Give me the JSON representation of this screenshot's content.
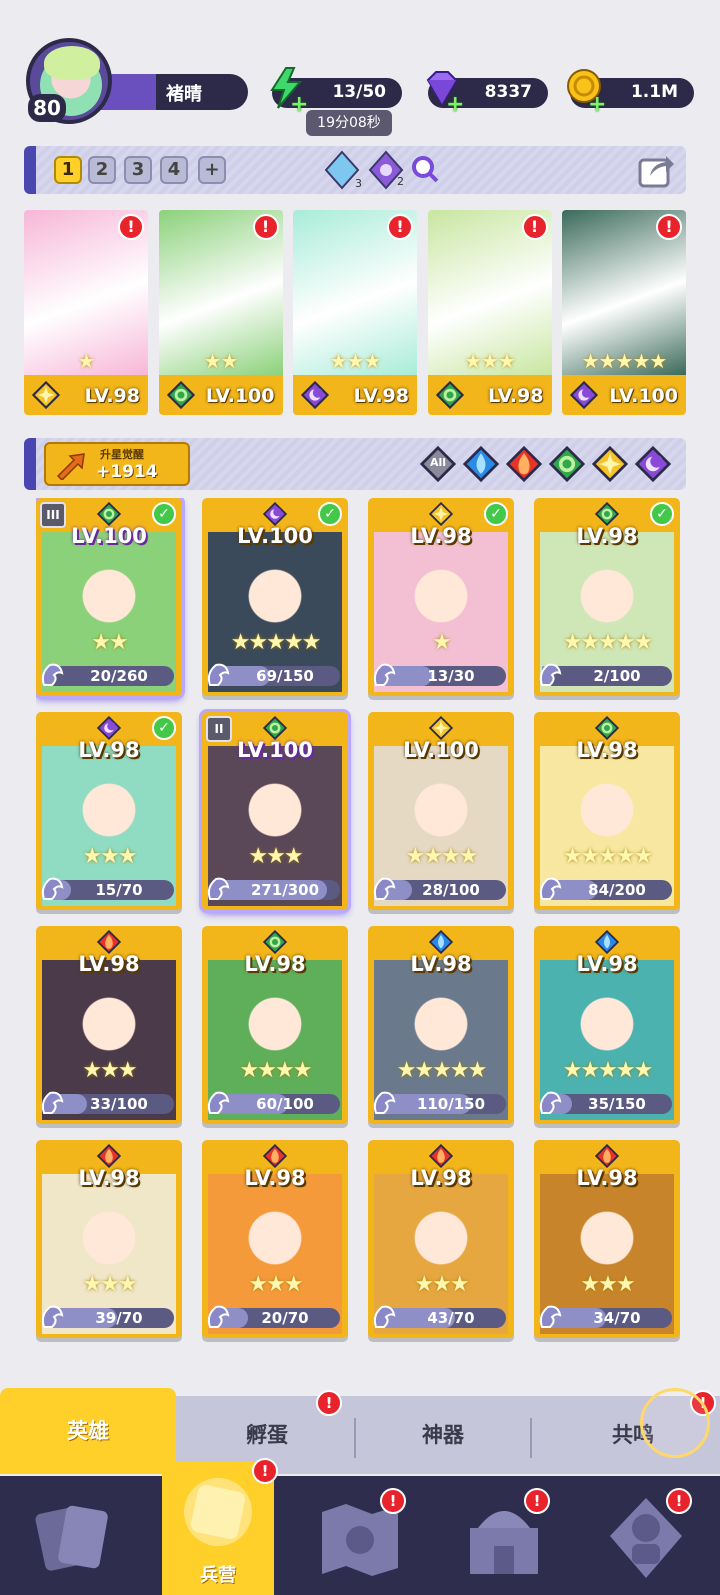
{
  "player": {
    "level": "80",
    "name": "褚晴"
  },
  "resources": {
    "energy": "13/50",
    "energy_timer": "19分08秒",
    "gems": "8337",
    "coins": "1.1M"
  },
  "team": {
    "slots": [
      "1",
      "2",
      "3",
      "4",
      "+"
    ],
    "slot_active": 0,
    "counter_a": "3",
    "counter_b": "2",
    "cards": [
      {
        "level": "LV.98",
        "element": "light",
        "stars": "★",
        "alert": "!"
      },
      {
        "level": "LV.100",
        "element": "nature",
        "stars": "★★",
        "alert": "!"
      },
      {
        "level": "LV.98",
        "element": "dark",
        "stars": "★★★",
        "alert": "!"
      },
      {
        "level": "LV.98",
        "element": "nature",
        "stars": "★★★",
        "alert": "!"
      },
      {
        "level": "LV.100",
        "element": "dark",
        "stars": "★★★★★",
        "alert": "!"
      }
    ]
  },
  "awaken": {
    "title": "升星觉醒",
    "value": "+1914"
  },
  "filters": [
    "All",
    "water",
    "fire",
    "nature",
    "light",
    "dark"
  ],
  "filter_all_label": "All",
  "heroes": [
    {
      "level": "LV.100",
      "element": "nature",
      "stars": "★★",
      "progress": "20/260",
      "fill": 0.08,
      "check": true,
      "tier": "III",
      "highlight": true,
      "purple": true,
      "art": "#8bd17a"
    },
    {
      "level": "LV.100",
      "element": "dark",
      "stars": "★★★★★",
      "progress": "69/150",
      "fill": 0.46,
      "check": true,
      "tier": "",
      "highlight": false,
      "purple": false,
      "art": "#3b4a5a"
    },
    {
      "level": "LV.98",
      "element": "light",
      "stars": "★",
      "progress": "13/30",
      "fill": 0.43,
      "check": true,
      "tier": "",
      "highlight": false,
      "purple": false,
      "art": "#f2c0d2"
    },
    {
      "level": "LV.98",
      "element": "nature",
      "stars": "★★★★★",
      "progress": "2/100",
      "fill": 0.02,
      "check": true,
      "tier": "",
      "highlight": false,
      "purple": false,
      "art": "#cfe7b6"
    },
    {
      "level": "LV.98",
      "element": "dark",
      "stars": "★★★",
      "progress": "15/70",
      "fill": 0.21,
      "check": true,
      "tier": "",
      "highlight": false,
      "purple": false,
      "art": "#8fdcc2"
    },
    {
      "level": "LV.100",
      "element": "nature",
      "stars": "★★★",
      "progress": "271/300",
      "fill": 0.9,
      "check": false,
      "tier": "II",
      "highlight": true,
      "purple": true,
      "art": "#5a4858"
    },
    {
      "level": "LV.100",
      "element": "light",
      "stars": "★★★★",
      "progress": "28/100",
      "fill": 0.28,
      "check": false,
      "tier": "",
      "highlight": false,
      "purple": false,
      "art": "#e6d9c4"
    },
    {
      "level": "LV.98",
      "element": "nature",
      "stars": "★★★★★",
      "progress": "84/200",
      "fill": 0.42,
      "check": false,
      "tier": "",
      "highlight": false,
      "purple": false,
      "art": "#f7e7a0"
    },
    {
      "level": "LV.98",
      "element": "fire",
      "stars": "★★★",
      "progress": "33/100",
      "fill": 0.33,
      "check": false,
      "tier": "",
      "highlight": false,
      "purple": false,
      "art": "#4a3a4a"
    },
    {
      "level": "LV.98",
      "element": "nature",
      "stars": "★★★★",
      "progress": "60/100",
      "fill": 0.6,
      "check": false,
      "tier": "",
      "highlight": false,
      "purple": false,
      "art": "#5fae5a"
    },
    {
      "level": "LV.98",
      "element": "water",
      "stars": "★★★★★",
      "progress": "110/150",
      "fill": 0.73,
      "check": false,
      "tier": "",
      "highlight": false,
      "purple": false,
      "art": "#6a7a8c"
    },
    {
      "level": "LV.98",
      "element": "water",
      "stars": "★★★★★",
      "progress": "35/150",
      "fill": 0.23,
      "check": false,
      "tier": "",
      "highlight": false,
      "purple": false,
      "art": "#4bb2b0"
    },
    {
      "level": "LV.98",
      "element": "fire",
      "stars": "★★★",
      "progress": "39/70",
      "fill": 0.56,
      "check": false,
      "tier": "",
      "highlight": false,
      "purple": false,
      "art": "#f0e6c8"
    },
    {
      "level": "LV.98",
      "element": "fire",
      "stars": "★★★",
      "progress": "20/70",
      "fill": 0.29,
      "check": false,
      "tier": "",
      "highlight": false,
      "purple": false,
      "art": "#f59a3a"
    },
    {
      "level": "LV.98",
      "element": "fire",
      "stars": "★★★",
      "progress": "43/70",
      "fill": 0.61,
      "check": false,
      "tier": "",
      "highlight": false,
      "purple": false,
      "art": "#e6a640"
    },
    {
      "level": "LV.98",
      "element": "fire",
      "stars": "★★★",
      "progress": "34/70",
      "fill": 0.49,
      "check": false,
      "tier": "",
      "highlight": false,
      "purple": false,
      "art": "#c8842a"
    }
  ],
  "subtabs": [
    {
      "label": "英雄",
      "active": true,
      "alert": false
    },
    {
      "label": "孵蛋",
      "active": false,
      "alert": true
    },
    {
      "label": "神器",
      "active": false,
      "alert": false
    },
    {
      "label": "共鸣",
      "active": false,
      "alert": true
    }
  ],
  "navbar": {
    "active_label": "兵营",
    "items": [
      "cards",
      "barracks",
      "map",
      "castle",
      "guild"
    ],
    "alert": "!"
  },
  "colors": {
    "gold": "#f3b61a",
    "navy": "#2c2a48",
    "alert": "#e8232b",
    "accent_purple": "#4a46b0"
  }
}
